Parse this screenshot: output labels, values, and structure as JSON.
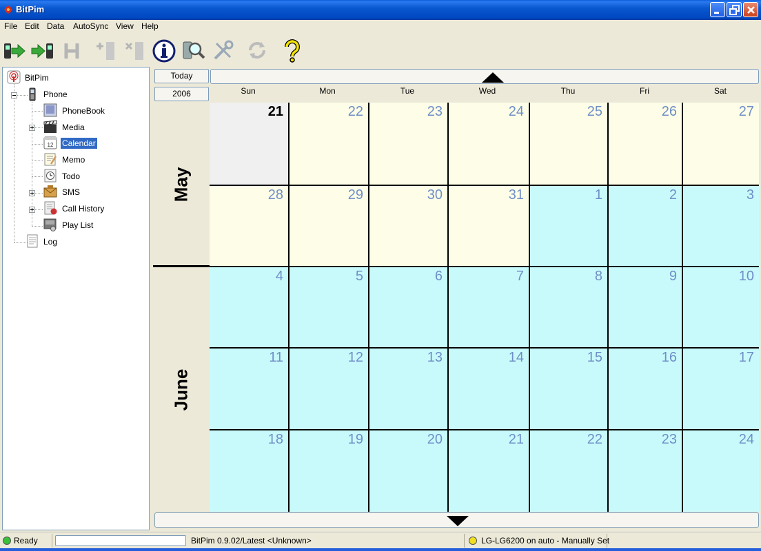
{
  "window": {
    "title": "BitPim"
  },
  "menu": [
    "File",
    "Edit",
    "Data",
    "AutoSync",
    "View",
    "Help"
  ],
  "toolbar": {
    "buttons": [
      {
        "name": "get-phone-data-icon"
      },
      {
        "name": "send-phone-data-icon"
      },
      {
        "name": "history-icon"
      },
      {
        "name": "add-entry-icon"
      },
      {
        "name": "delete-entry-icon"
      },
      {
        "name": "info-icon"
      },
      {
        "name": "find-phone-icon"
      },
      {
        "name": "settings-tools-icon"
      },
      {
        "name": "refresh-icon"
      },
      {
        "name": "help-icon"
      }
    ]
  },
  "tree": {
    "root": "BitPim",
    "phone": "Phone",
    "items": [
      "PhoneBook",
      "Media",
      "Calendar",
      "Memo",
      "Todo",
      "SMS",
      "Call History",
      "Play List"
    ],
    "selected": "Calendar",
    "log": "Log"
  },
  "calendar": {
    "today_label": "Today",
    "year": "2006",
    "days_of_week": [
      "Sun",
      "Mon",
      "Tue",
      "Wed",
      "Thu",
      "Fri",
      "Sat"
    ],
    "months": [
      "May",
      "June"
    ],
    "weeks": [
      [
        {
          "d": "21",
          "m": "may",
          "today": true
        },
        {
          "d": "22",
          "m": "may"
        },
        {
          "d": "23",
          "m": "may"
        },
        {
          "d": "24",
          "m": "may"
        },
        {
          "d": "25",
          "m": "may"
        },
        {
          "d": "26",
          "m": "may"
        },
        {
          "d": "27",
          "m": "may"
        }
      ],
      [
        {
          "d": "28",
          "m": "may"
        },
        {
          "d": "29",
          "m": "may"
        },
        {
          "d": "30",
          "m": "may"
        },
        {
          "d": "31",
          "m": "may"
        },
        {
          "d": "1",
          "m": "june"
        },
        {
          "d": "2",
          "m": "june"
        },
        {
          "d": "3",
          "m": "june"
        }
      ],
      [
        {
          "d": "4",
          "m": "june"
        },
        {
          "d": "5",
          "m": "june"
        },
        {
          "d": "6",
          "m": "june"
        },
        {
          "d": "7",
          "m": "june"
        },
        {
          "d": "8",
          "m": "june"
        },
        {
          "d": "9",
          "m": "june"
        },
        {
          "d": "10",
          "m": "june"
        }
      ],
      [
        {
          "d": "11",
          "m": "june"
        },
        {
          "d": "12",
          "m": "june"
        },
        {
          "d": "13",
          "m": "june"
        },
        {
          "d": "14",
          "m": "june"
        },
        {
          "d": "15",
          "m": "june"
        },
        {
          "d": "16",
          "m": "june"
        },
        {
          "d": "17",
          "m": "june"
        }
      ],
      [
        {
          "d": "18",
          "m": "june"
        },
        {
          "d": "19",
          "m": "june"
        },
        {
          "d": "20",
          "m": "june"
        },
        {
          "d": "21",
          "m": "june"
        },
        {
          "d": "22",
          "m": "june"
        },
        {
          "d": "23",
          "m": "june"
        },
        {
          "d": "24",
          "m": "june"
        }
      ]
    ]
  },
  "status": {
    "ready": "Ready",
    "version": "BitPim 0.9.02/Latest <Unknown>",
    "phone": "LG-LG6200 on auto - Manually Set"
  },
  "colors": {
    "may_cell": "#fefee8",
    "june_cell": "#c9fafb",
    "day_number": "#6f8fc8",
    "selection": "#316ac5"
  }
}
